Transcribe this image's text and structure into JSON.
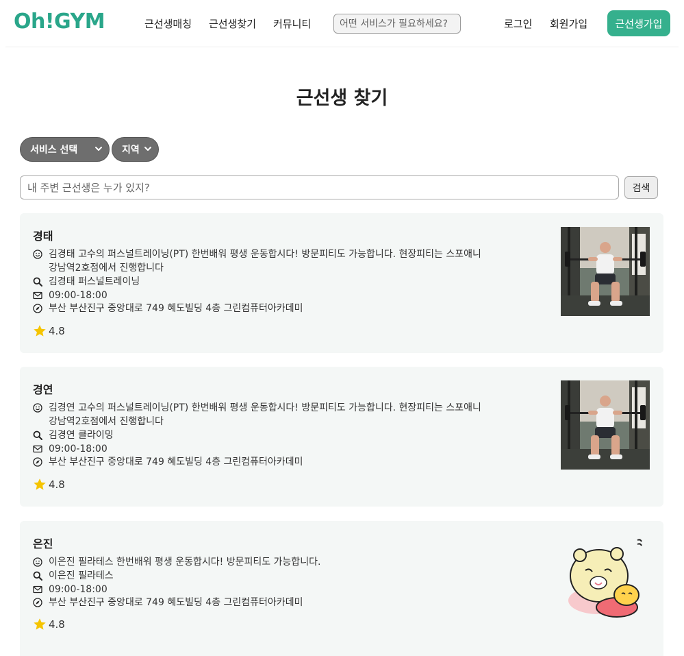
{
  "header": {
    "logo": "Oh!GYM",
    "nav": [
      "근선생매칭",
      "근선생찾기",
      "커뮤니티"
    ],
    "search_placeholder": "어떤 서비스가 필요하세요?",
    "login": "로그인",
    "signup": "회원가입",
    "cta": "근선생가입"
  },
  "page": {
    "title": "근선생 찾기"
  },
  "filters": {
    "service": "서비스 선택",
    "region": "지역",
    "search_placeholder": "내 주변 근선생은 누가 있지?",
    "search_button": "검색"
  },
  "colors": {
    "brand": "#2aa68a",
    "cta": "#35b08d",
    "star": "#f5c400",
    "card_bg": "#f4f7f6"
  },
  "trainers": [
    {
      "name": "경태",
      "intro": "김경태 고수의 퍼스널트레이닝(PT) 한번배워 평생 운동합시다! 방문피티도 가능합니다. 현장피티는 스포애니강남역2호점에서 진행합니다",
      "service": "김경태 퍼스널트레이닝",
      "hours": "09:00-18:00",
      "address": "부산 부산진구 중앙대로 749 혜도빌딩 4층 그린컴퓨터아카데미",
      "rating": "4.8",
      "photo": "squat-photo"
    },
    {
      "name": "경연",
      "intro": "김경연 고수의 퍼스널트레이닝(PT) 한번배워 평생 운동합시다! 방문피티도 가능합니다. 현장피티는 스포애니강남역2호점에서 진행합니다",
      "service": "김경연 클라이밍",
      "hours": "09:00-18:00",
      "address": "부산 부산진구 중앙대로 749 혜도빌딩 4층 그린컴퓨터아카데미",
      "rating": "4.8",
      "photo": "squat-photo"
    },
    {
      "name": "은진",
      "intro": "이은진 필라테스 한번배워 평생 운동합시다! 방문피티도 가능합니다.",
      "service": "이은진 필라테스",
      "hours": "09:00-18:00",
      "address": "부산 부산진구 중앙대로 749 혜도빌딩 4층 그린컴퓨터아카데미",
      "rating": "4.8",
      "photo": "cartoon-illustration"
    }
  ]
}
